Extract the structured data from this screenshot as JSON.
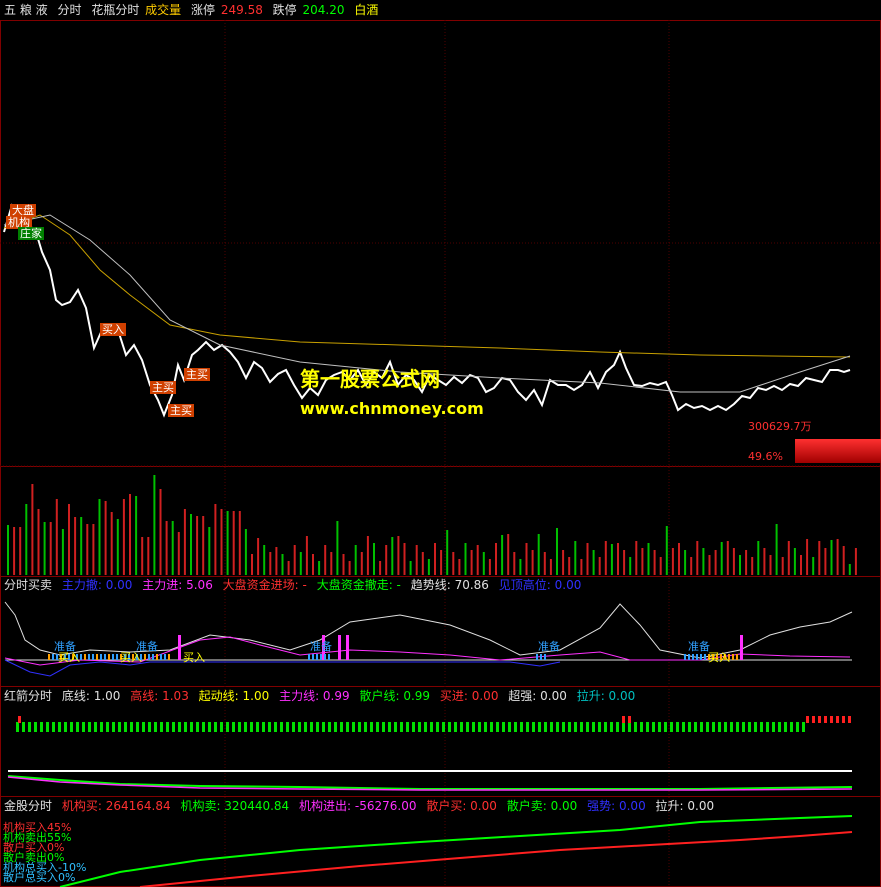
{
  "header": {
    "name": "五 粮 液",
    "period": "分时",
    "indicator": "花瓶分时",
    "volume_label": "成交量",
    "limit_up_label": "涨停",
    "limit_up_value": "249.58",
    "limit_down_label": "跌停",
    "limit_down_value": "204.20",
    "sector": "白酒"
  },
  "main_chart": {
    "tags": [
      "大盘",
      "机构",
      "庄家",
      "买入",
      "主买",
      "主买",
      "主买"
    ],
    "watermark_title": "第一股票公式网",
    "watermark_url": "www.chnmoney.com",
    "amount_text": "300629.7万",
    "percent_text": "49.6%",
    "percent_value": 49.6
  },
  "panel1": {
    "title": "分时买卖",
    "items": [
      {
        "label": "主力撤: 0.00",
        "color": "#3030ff"
      },
      {
        "label": "主力进: 5.06",
        "color": "#ff30ff"
      },
      {
        "label": "大盘资金进场: -",
        "color": "#ff3030"
      },
      {
        "label": "大盘资金撤走: -",
        "color": "#00ff00"
      },
      {
        "label": "趋势线: 70.86",
        "color": "#e0e0e0"
      },
      {
        "label": "见顶高位: 0.00",
        "color": "#3030ff"
      }
    ],
    "tags": [
      "准备",
      "准备",
      "买入",
      "买入",
      "买入",
      "准备",
      "准备",
      "准备",
      "买入"
    ]
  },
  "panel2": {
    "title": "红箭分时",
    "items": [
      {
        "label": "底线: 1.00",
        "color": "#e0e0e0"
      },
      {
        "label": "高线: 1.03",
        "color": "#ff3030"
      },
      {
        "label": "起动线: 1.00",
        "color": "#ffff00"
      },
      {
        "label": "主力线: 0.99",
        "color": "#ff30ff"
      },
      {
        "label": "散户线: 0.99",
        "color": "#00ff00"
      },
      {
        "label": "买进: 0.00",
        "color": "#ff3030"
      },
      {
        "label": "超强: 0.00",
        "color": "#e0e0e0"
      },
      {
        "label": "拉升: 0.00",
        "color": "#00c0c0"
      }
    ]
  },
  "panel3": {
    "title": "金股分时",
    "items": [
      {
        "label": "机构买: 264164.84",
        "color": "#ff3030"
      },
      {
        "label": "机构卖: 320440.84",
        "color": "#00ff00"
      },
      {
        "label": "机构进出: -56276.00",
        "color": "#ff30ff"
      },
      {
        "label": "散户买: 0.00",
        "color": "#ff3030"
      },
      {
        "label": "散户卖: 0.00",
        "color": "#00ff00"
      },
      {
        "label": "强势: 0.00",
        "color": "#3030ff"
      },
      {
        "label": "拉升: 0.00",
        "color": "#e0e0e0"
      }
    ],
    "legend": [
      {
        "label": "机构买入45%",
        "color": "#ff3030"
      },
      {
        "label": "机构卖出55%",
        "color": "#00ff00"
      },
      {
        "label": "散户买入0%",
        "color": "#ff3030"
      },
      {
        "label": "散户卖出0%",
        "color": "#00ff00"
      },
      {
        "label": "机构总买入-10%",
        "color": "#30c0ff"
      },
      {
        "label": "散户总买入0%",
        "color": "#30c0ff"
      }
    ]
  }
}
